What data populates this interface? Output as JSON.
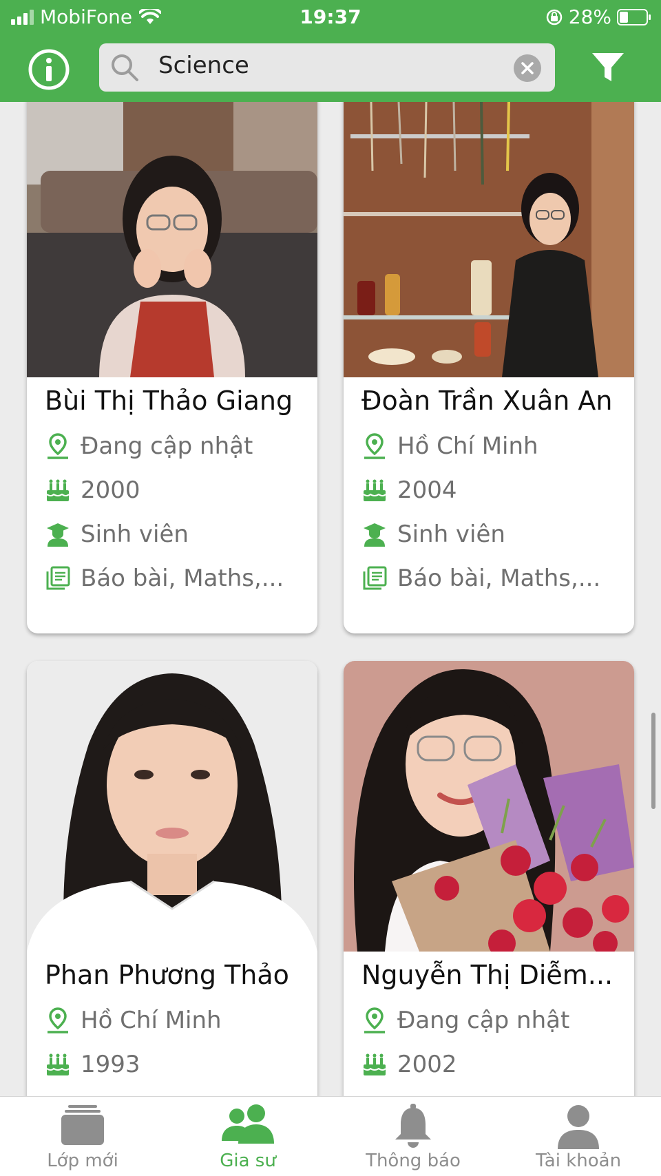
{
  "status_bar": {
    "carrier": "MobiFone",
    "time": "19:37",
    "battery": "28%"
  },
  "search": {
    "query": "Science"
  },
  "tutors": [
    {
      "name": "Bùi Thị Thảo Giang",
      "location": "Đang cập nhật",
      "birth_year": "2000",
      "occupation": "Sinh viên",
      "subjects": "Báo bài, Maths,..."
    },
    {
      "name": "Đoàn Trần Xuân An",
      "location": "Hồ Chí Minh",
      "birth_year": "2004",
      "occupation": "Sinh viên",
      "subjects": "Báo bài, Maths,..."
    },
    {
      "name": "Phan Phương Thảo",
      "location": "Hồ Chí Minh",
      "birth_year": "1993"
    },
    {
      "name": "Nguyễn Thị Diễm...",
      "location": "Đang cập nhật",
      "birth_year": "2002"
    }
  ],
  "tabs": [
    {
      "label": "Lớp mới",
      "icon": "classes-icon"
    },
    {
      "label": "Gia sư",
      "icon": "tutors-icon",
      "active": true
    },
    {
      "label": "Thông báo",
      "icon": "bell-icon"
    },
    {
      "label": "Tài khoản",
      "icon": "account-icon"
    }
  ],
  "colors": {
    "primary": "#4cb050",
    "text_secondary": "#6f6f6f",
    "tab_inactive": "#8e8e8e"
  }
}
